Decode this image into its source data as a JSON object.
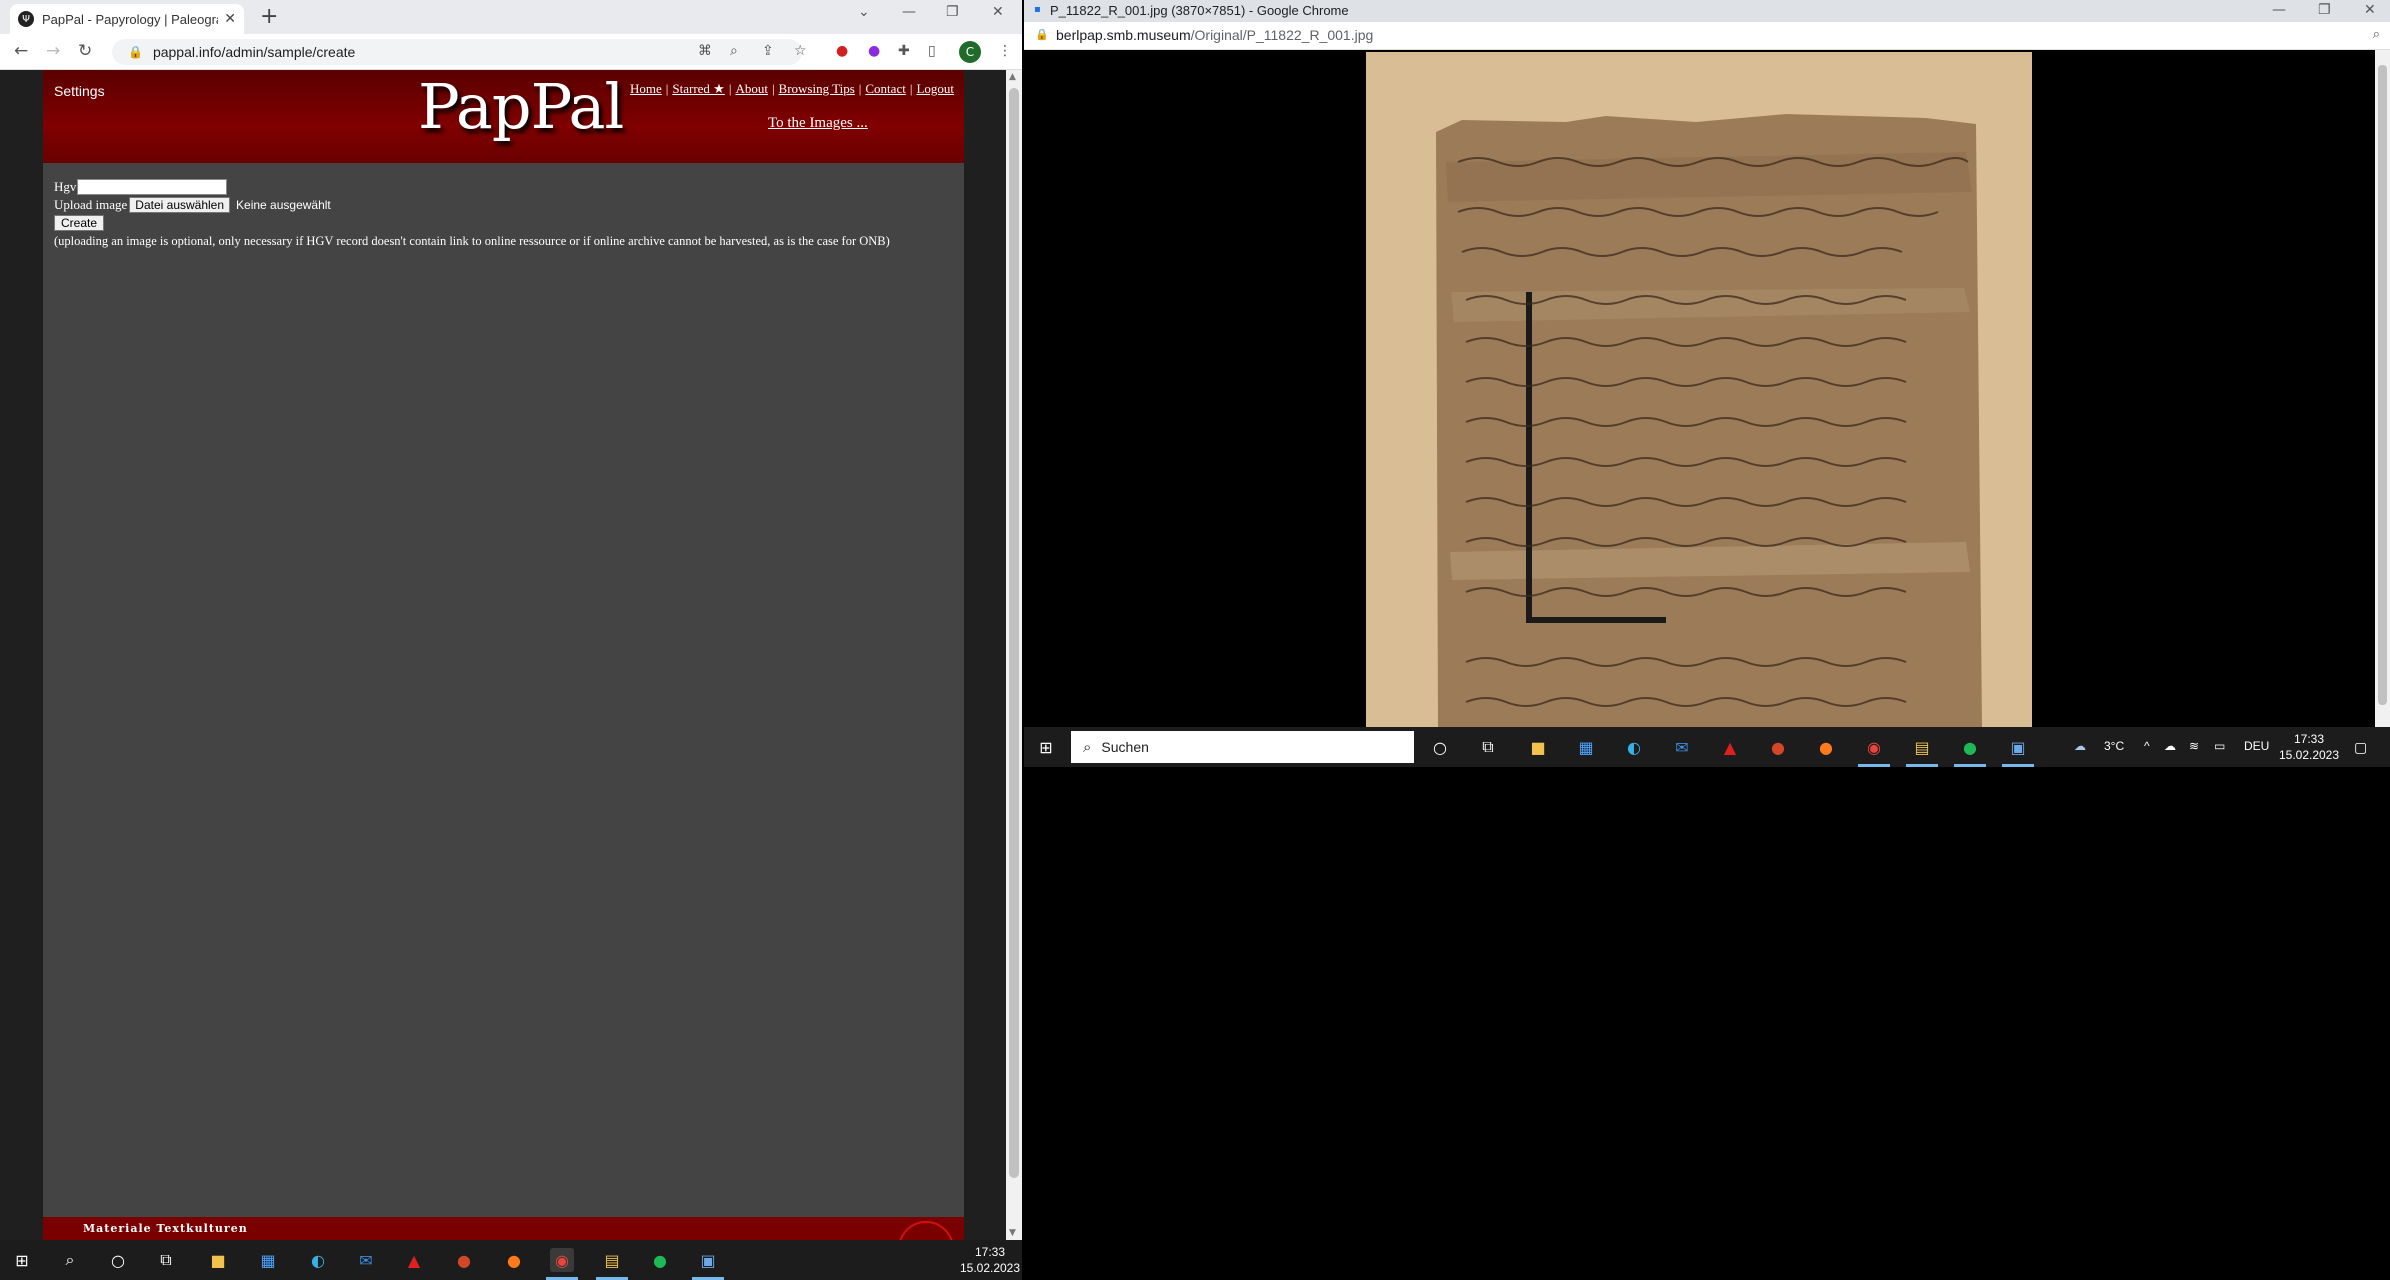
{
  "left_window": {
    "tab_title": "PapPal - Papyrology | Paleography",
    "url": "pappal.info/admin/sample/create"
  },
  "site": {
    "settings_label": "Settings",
    "logo_text": "PapPal",
    "nav": [
      "Home",
      "Starred ★",
      "About",
      "Browsing Tips",
      "Contact",
      "Logout"
    ],
    "to_images_label": "To the Images ...",
    "form": {
      "hgv_label": "Hgv",
      "hgv_value": "",
      "upload_label": "Upload image",
      "file_button_label": "Datei auswählen",
      "file_status": "Keine ausgewählt",
      "create_button_label": "Create",
      "note": "(uploading an image is optional, only necessary if HGV record doesn't contain link to online ressource or if online archive cannot be harvested, as is the case for ONB)"
    },
    "footer_text": "Materiale Textkulturen"
  },
  "right_window": {
    "title": "P_11822_R_001.jpg (3870×7851) - Google Chrome",
    "url_host": "berlpap.smb.museum",
    "url_path": "/Original/P_11822_R_001.jpg"
  },
  "taskbar_right": {
    "search_placeholder": "Suchen",
    "weather": "3°C",
    "language": "DEU",
    "time": "17:33",
    "date": "15.02.2023"
  },
  "taskbar_left": {
    "time": "17:33",
    "date": "15.02.2023"
  }
}
